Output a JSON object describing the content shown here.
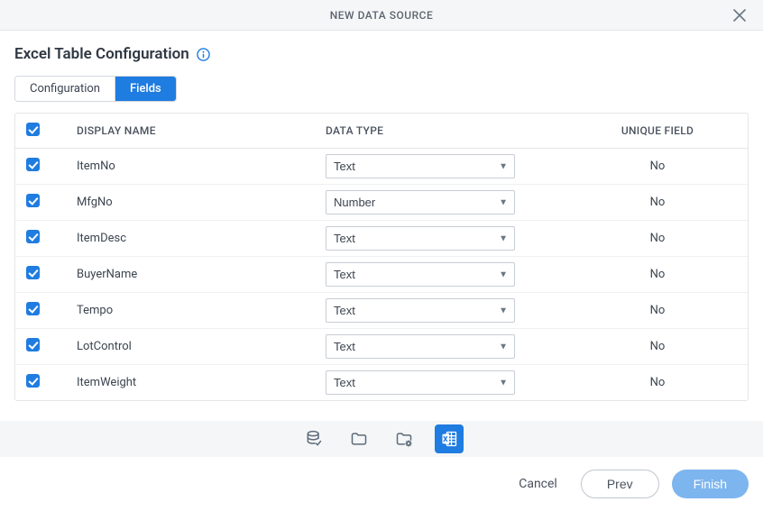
{
  "modal": {
    "title": "NEW DATA SOURCE"
  },
  "page": {
    "title": "Excel Table Configuration"
  },
  "tabs": [
    {
      "label": "Configuration",
      "active": false
    },
    {
      "label": "Fields",
      "active": true
    }
  ],
  "table": {
    "headers": {
      "check": "",
      "display_name": "DISPLAY NAME",
      "data_type": "DATA TYPE",
      "unique_field": "UNIQUE FIELD"
    },
    "data_type_options": [
      "Text",
      "Number"
    ],
    "rows": [
      {
        "checked": true,
        "display_name": "ItemNo",
        "data_type": "Text",
        "unique_field": "No"
      },
      {
        "checked": true,
        "display_name": "MfgNo",
        "data_type": "Number",
        "unique_field": "No"
      },
      {
        "checked": true,
        "display_name": "ItemDesc",
        "data_type": "Text",
        "unique_field": "No"
      },
      {
        "checked": true,
        "display_name": "BuyerName",
        "data_type": "Text",
        "unique_field": "No"
      },
      {
        "checked": true,
        "display_name": "Tempo",
        "data_type": "Text",
        "unique_field": "No"
      },
      {
        "checked": true,
        "display_name": "LotControl",
        "data_type": "Text",
        "unique_field": "No"
      },
      {
        "checked": true,
        "display_name": "ItemWeight",
        "data_type": "Text",
        "unique_field": "No"
      }
    ]
  },
  "footer": {
    "cancel": "Cancel",
    "prev": "Prev",
    "finish": "Finish"
  }
}
